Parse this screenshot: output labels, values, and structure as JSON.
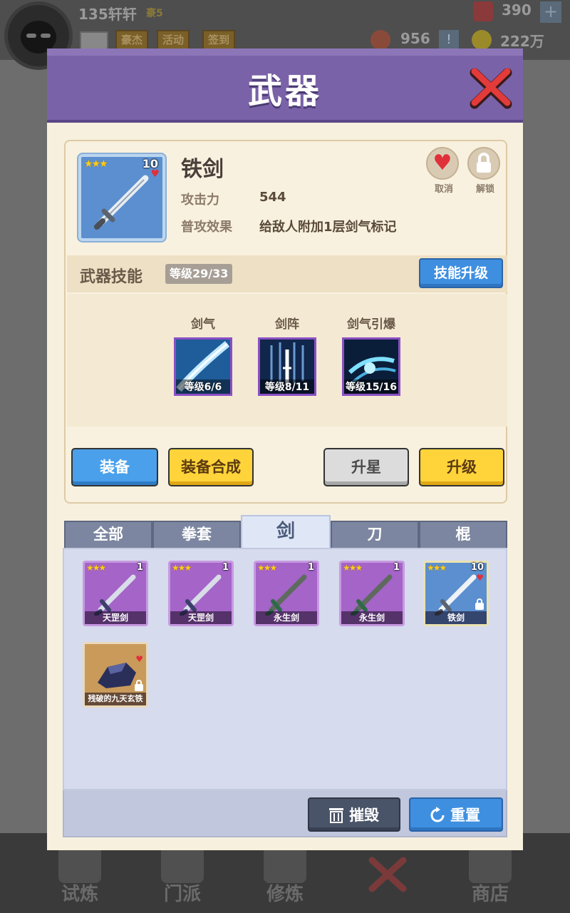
{
  "hud": {
    "player_name": "135轩轩",
    "vip": "豪5",
    "buttons": [
      "豪杰",
      "活动",
      "签到"
    ],
    "gems": "390",
    "tokens": "956",
    "gold": "222万"
  },
  "nav": {
    "items": [
      "试炼",
      "门派",
      "修炼",
      "",
      "商店"
    ]
  },
  "dialog": {
    "title": "武器",
    "close_icon": "close-x-icon"
  },
  "weapon": {
    "name": "铁剑",
    "stars": "★★★",
    "level": "10",
    "attack_label": "攻击力",
    "attack_value": "544",
    "effect_label": "普攻效果",
    "effect_value": "给敌人附加1层剑气标记",
    "cancel_label": "取消",
    "unlock_label": "解锁"
  },
  "skills": {
    "title": "武器技能",
    "level": "等级29/33",
    "upgrade_label": "技能升级",
    "items": [
      {
        "name": "剑气",
        "level": "等级6/6"
      },
      {
        "name": "剑阵",
        "level": "等级8/11"
      },
      {
        "name": "剑气引爆",
        "level": "等级15/16"
      }
    ]
  },
  "actions": {
    "equip": "装备",
    "compose": "装备合成",
    "star_up": "升星",
    "upgrade": "升级"
  },
  "tabs": [
    {
      "label": "全部",
      "active": false
    },
    {
      "label": "拳套",
      "active": false
    },
    {
      "label": "剑",
      "active": true
    },
    {
      "label": "刀",
      "active": false
    },
    {
      "label": "棍",
      "active": false
    }
  ],
  "inventory": [
    {
      "name": "天罡剑",
      "stars": "★★★",
      "count": "1",
      "rarity": "purple"
    },
    {
      "name": "天罡剑",
      "stars": "★★★",
      "count": "1",
      "rarity": "purple"
    },
    {
      "name": "永生剑",
      "stars": "★★★",
      "count": "1",
      "rarity": "purple"
    },
    {
      "name": "永生剑",
      "stars": "★★★",
      "count": "1",
      "rarity": "purple"
    },
    {
      "name": "铁剑",
      "stars": "★★★",
      "count": "10",
      "rarity": "blue",
      "locked": true,
      "favorite": true
    },
    {
      "name": "残破的九天玄铁",
      "stars": "",
      "count": "",
      "rarity": "brown",
      "locked": true,
      "favorite": true
    }
  ],
  "footer": {
    "destroy": "摧毁",
    "reset": "重置"
  },
  "colors": {
    "header": "#7a62a8",
    "button_blue": "#4aa0ea",
    "button_yellow": "#ffd43a",
    "rarity_purple": "#a464c8",
    "rarity_blue": "#5b8fd0"
  }
}
